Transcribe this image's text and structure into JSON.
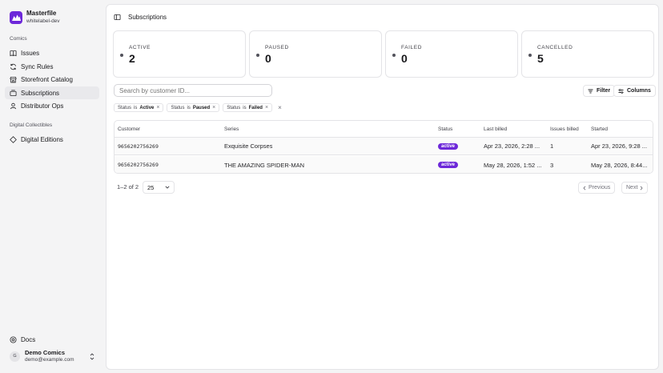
{
  "brand": {
    "name": "Masterfile",
    "subtitle": "whitelabel-dev"
  },
  "sidebar": {
    "groups": [
      {
        "label": "Comics"
      },
      {
        "label": "Digital Collectibles"
      }
    ],
    "items": [
      {
        "label": "Issues",
        "icon": "book-icon"
      },
      {
        "label": "Sync Rules",
        "icon": "refresh-icon"
      },
      {
        "label": "Storefront Catalog",
        "icon": "storefront-icon"
      },
      {
        "label": "Subscriptions",
        "icon": "subscriptions-icon",
        "active": true
      },
      {
        "label": "Distributor Ops",
        "icon": "user-icon"
      },
      {
        "label": "Digital Editions",
        "icon": "diamond-icon"
      }
    ],
    "docs": {
      "label": "Docs",
      "icon": "help-icon"
    },
    "user": {
      "initial": "G",
      "name": "Demo Comics",
      "email": "demo@example.com"
    }
  },
  "header": {
    "title": "Subscriptions"
  },
  "stats": [
    {
      "label": "ACTIVE",
      "value": "2"
    },
    {
      "label": "PAUSED",
      "value": "0"
    },
    {
      "label": "FAILED",
      "value": "0"
    },
    {
      "label": "CANCELLED",
      "value": "5"
    }
  ],
  "search": {
    "placeholder": "Search by customer ID..."
  },
  "toolbar": {
    "filter_label": "Filter",
    "columns_label": "Columns"
  },
  "filters": [
    {
      "field": "Status",
      "op": "is",
      "value": "Active"
    },
    {
      "field": "Status",
      "op": "is",
      "value": "Paused"
    },
    {
      "field": "Status",
      "op": "is",
      "value": "Failed"
    }
  ],
  "table": {
    "columns": [
      "Customer",
      "Series",
      "Status",
      "Last billed",
      "Issues billed",
      "Started"
    ],
    "rows": [
      {
        "customer": "9656202756269",
        "series": "Exquisite Corpses",
        "status": "active",
        "last_billed": "Apr 23, 2026, 2:28 ...",
        "issues_billed": "1",
        "started": "Apr 23, 2026, 9:28 ..."
      },
      {
        "customer": "9656202756269",
        "series": "THE AMAZING SPIDER-MAN",
        "status": "active",
        "last_billed": "May 28, 2026, 1:52 ...",
        "issues_billed": "3",
        "started": "May 28, 2026, 8:44..."
      }
    ]
  },
  "pagination": {
    "range": "1–2 of 2",
    "page_size": "25",
    "prev_label": "Previous",
    "next_label": "Next"
  },
  "colors": {
    "accent": "#6d28d9",
    "background": "#f4f4f5",
    "panel": "#ffffff",
    "border": "#e4e4e7"
  }
}
